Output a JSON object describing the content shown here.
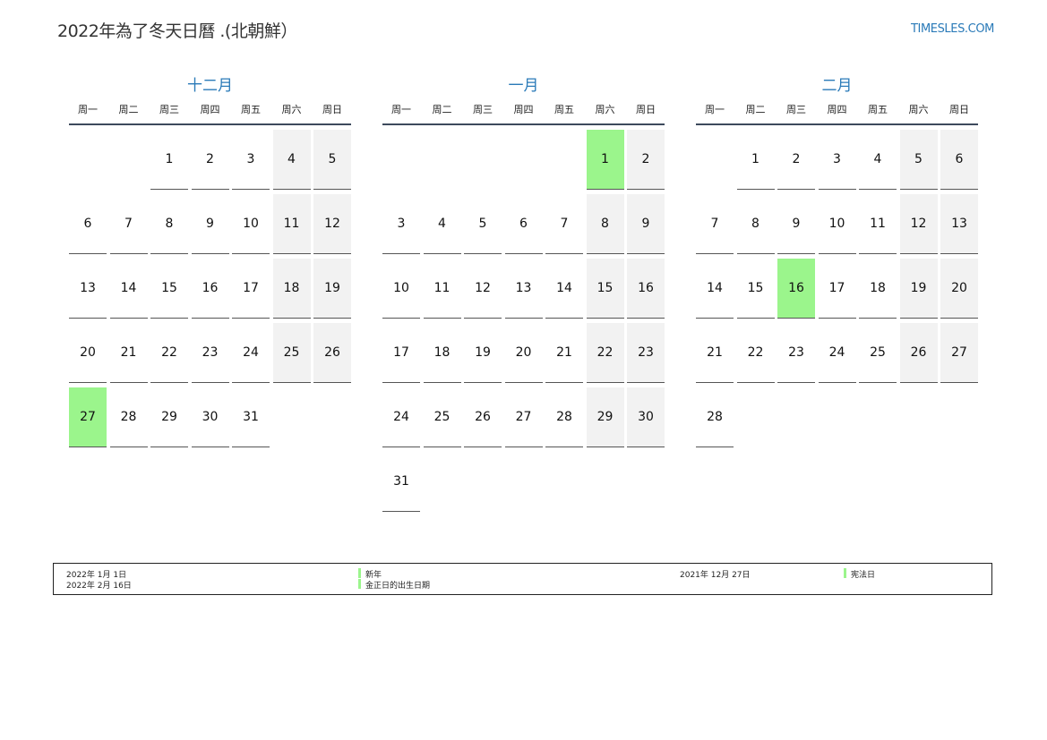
{
  "header": {
    "title": "2022年為了冬天日曆 .(北朝鮮）",
    "site": "TIMESLES.COM"
  },
  "weekdays": [
    "周一",
    "周二",
    "周三",
    "周四",
    "周五",
    "周六",
    "周日"
  ],
  "months": [
    {
      "name": "十二月",
      "offset": 2,
      "days": 31,
      "holidays": [
        27
      ]
    },
    {
      "name": "一月",
      "offset": 5,
      "days": 31,
      "holidays": [
        1
      ]
    },
    {
      "name": "二月",
      "offset": 1,
      "days": 28,
      "holidays": [
        16
      ]
    }
  ],
  "legend": {
    "items": [
      {
        "date": "2022年 1月 1日",
        "name": "新年"
      },
      {
        "date": "2022年 2月 16日",
        "name": "金正日的出生日期"
      },
      {
        "date": "2021年 12月 27日",
        "name": "宪法日"
      }
    ],
    "marker_color": "#9bf58c"
  },
  "colors": {
    "accent": "#2a7ab8",
    "weekend": "#f2f2f2",
    "holiday": "#9bf58c"
  }
}
